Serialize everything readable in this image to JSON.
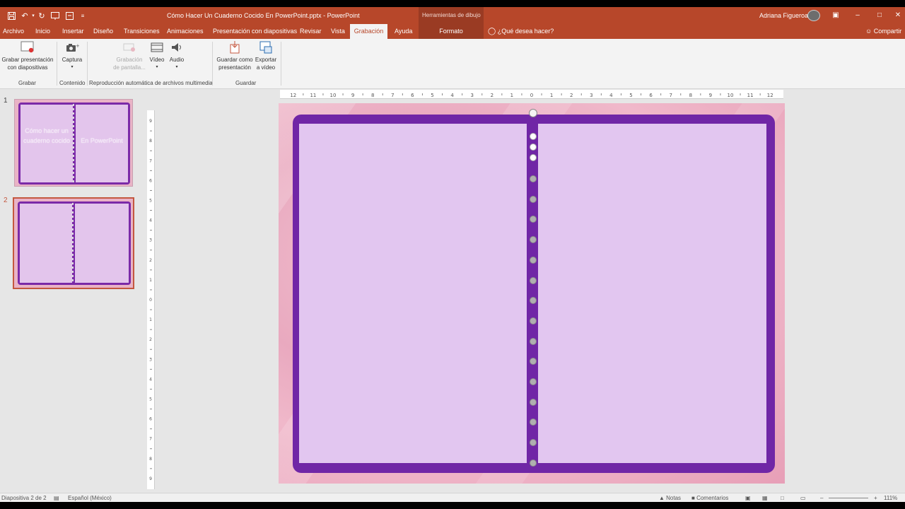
{
  "window": {
    "title": "Cómo Hacer Un Cuaderno Cocido En PowerPoint.pptx  -  PowerPoint",
    "context_tool": "Herramientas de dibujo",
    "user": "Adriana Figueroa"
  },
  "tabs": [
    {
      "label": "Archivo"
    },
    {
      "label": "Inicio"
    },
    {
      "label": "Insertar"
    },
    {
      "label": "Diseño"
    },
    {
      "label": "Transiciones"
    },
    {
      "label": "Animaciones"
    },
    {
      "label": "Presentación con diapositivas"
    },
    {
      "label": "Revisar"
    },
    {
      "label": "Vista"
    },
    {
      "label": "Grabación"
    },
    {
      "label": "Ayuda"
    },
    {
      "label": "Formato"
    }
  ],
  "tell_me": "¿Qué desea hacer?",
  "share": "Compartir",
  "ribbon": {
    "record": {
      "line1": "Grabar presentación",
      "line2": "con diapositivas",
      "group": "Grabar"
    },
    "capture": {
      "label": "Captura",
      "group": "Contenido"
    },
    "screen_rec": {
      "line1": "Grabación",
      "line2": "de pantalla..."
    },
    "video": {
      "label": "Vídeo"
    },
    "audio": {
      "label": "Audio"
    },
    "media_group": "Reproducción automática de archivos multimedia",
    "save_pres": {
      "line1": "Guardar como",
      "line2": "presentación"
    },
    "export_video": {
      "line1": "Exportar",
      "line2": "a vídeo"
    },
    "save_group": "Guardar"
  },
  "slides": [
    {
      "number": "1",
      "left_text": "Cómo hacer un cuaderno cocido",
      "right_text": "En PowerPoint"
    },
    {
      "number": "2"
    }
  ],
  "status": {
    "slide_info": "Diapositiva 2 de 2",
    "language": "Español (México)",
    "notes": "Notas",
    "comments": "Comentarios",
    "zoom": "111%"
  },
  "colors": {
    "accent": "#b7472a",
    "book_cover": "#7026a6",
    "page": "#e2c6f0",
    "background_pink": "#e9a9bf"
  }
}
